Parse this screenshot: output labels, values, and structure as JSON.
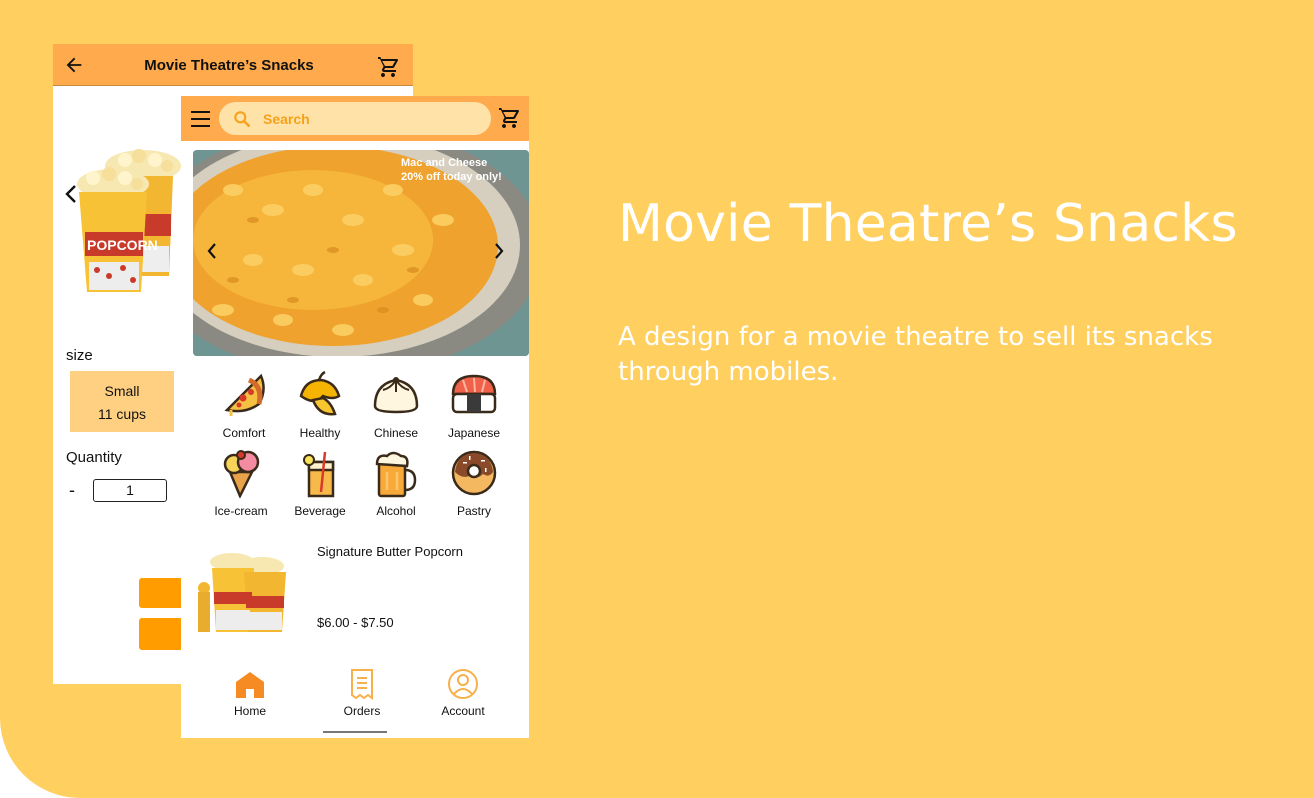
{
  "colors": {
    "background": "#ffd05f",
    "header": "#ffaa4c",
    "search_bg": "#ffe2a8",
    "accent": "#ff9c00",
    "size_option_bg": "#ffd081"
  },
  "detail_screen": {
    "title": "Movie Theatre’s Snacks",
    "back_icon": "arrow-left-icon",
    "cart_icon": "cart-icon",
    "size_label": "size",
    "size_option": {
      "name": "Small",
      "detail": "11 cups"
    },
    "quantity_label": "Quantity",
    "minus_label": "-",
    "quantity_value": "1"
  },
  "home_screen": {
    "search_placeholder": "Search",
    "banner": {
      "line1": "Mac and Cheese",
      "line2": "20% off today only!"
    },
    "categories": [
      {
        "label": "Comfort",
        "icon": "pizza-icon"
      },
      {
        "label": "Healthy",
        "icon": "mango-icon"
      },
      {
        "label": "Chinese",
        "icon": "dumpling-icon"
      },
      {
        "label": "Japanese",
        "icon": "sushi-icon"
      },
      {
        "label": "Ice-cream",
        "icon": "ice-cream-icon"
      },
      {
        "label": "Beverage",
        "icon": "beverage-icon"
      },
      {
        "label": "Alcohol",
        "icon": "beer-icon"
      },
      {
        "label": "Pastry",
        "icon": "donut-icon"
      }
    ],
    "product": {
      "name": "Signature Butter Popcorn",
      "price": "$6.00 - $7.50"
    },
    "nav": {
      "home": "Home",
      "orders": "Orders",
      "account": "Account"
    }
  },
  "hero": {
    "title": "Movie Theatre’s Snacks",
    "description": "A design for a movie theatre to sell its snacks through mobiles."
  }
}
